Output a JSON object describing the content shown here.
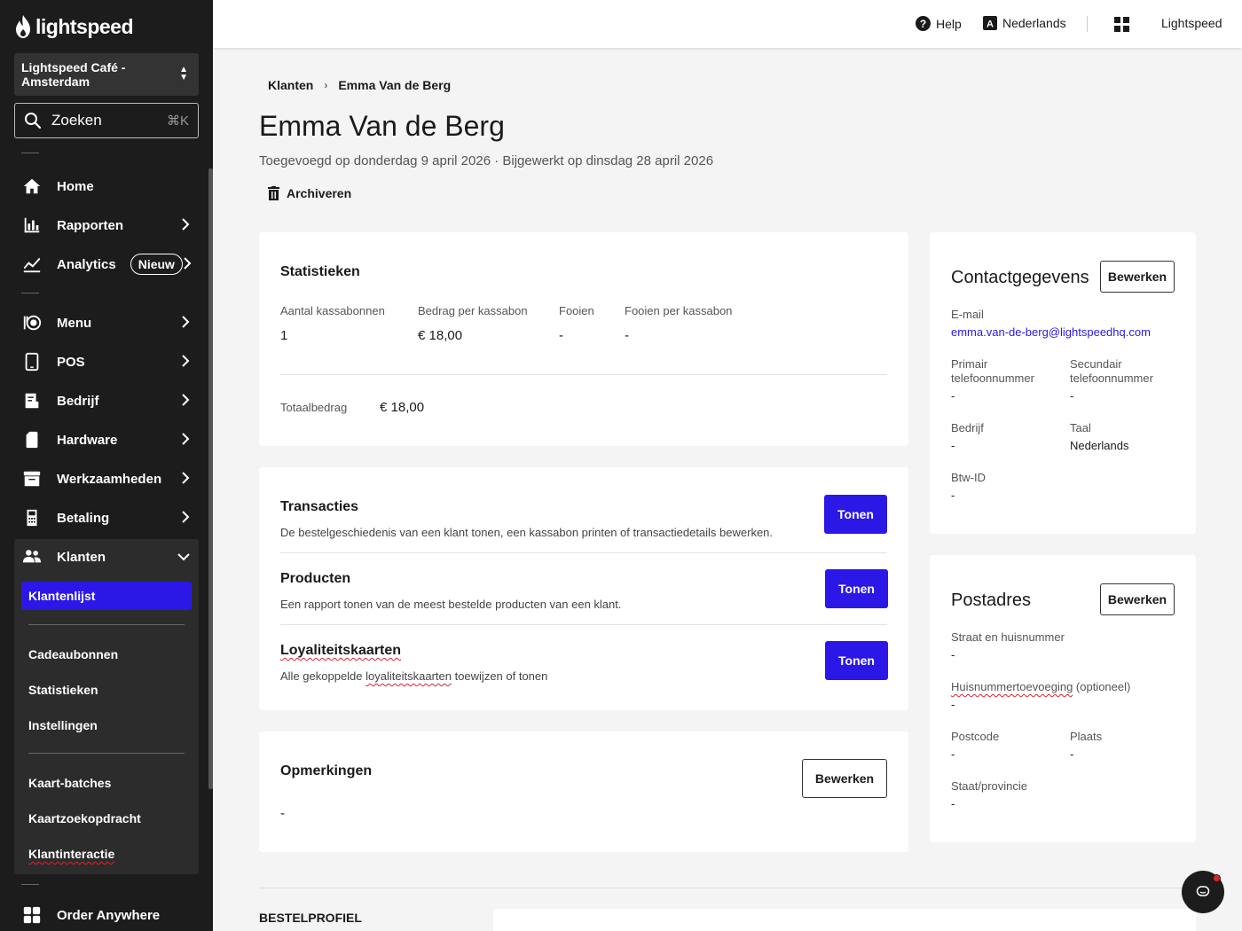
{
  "sidebar": {
    "brand": "lightspeed",
    "store": "Lightspeed Café - Amsterdam",
    "search": {
      "label": "Zoeken",
      "shortcut": "⌘K"
    },
    "items": [
      {
        "label": "Home"
      },
      {
        "label": "Rapporten"
      },
      {
        "label": "Analytics",
        "badge": "Nieuw"
      },
      {
        "label": "Menu"
      },
      {
        "label": "POS"
      },
      {
        "label": "Bedrijf"
      },
      {
        "label": "Hardware"
      },
      {
        "label": "Werkzaamheden"
      },
      {
        "label": "Betaling"
      },
      {
        "label": "Klanten"
      },
      {
        "label": "Order Anywhere"
      }
    ],
    "sub": [
      "Klantenlijst",
      "Cadeaubonnen",
      "Statistieken",
      "Instellingen",
      "Kaart-batches",
      "Kaartzoekopdracht",
      "Klantinteractie"
    ]
  },
  "topbar": {
    "help": "Help",
    "language": "Nederlands",
    "account": "Lightspeed"
  },
  "breadcrumb": {
    "parent": "Klanten",
    "current": "Emma Van de Berg"
  },
  "page": {
    "title": "Emma Van de Berg",
    "subtitle": "Toegevoegd op donderdag 9 april 2026 · Bijgewerkt op dinsdag 28 april 2026",
    "archive": "Archiveren"
  },
  "stats": {
    "title": "Statistieken",
    "labels": [
      "Aantal kassabonnen",
      "Bedrag per kassabon",
      "Fooien",
      "Fooien per kassabon"
    ],
    "values": [
      "1",
      "€ 18,00",
      "-",
      "-"
    ],
    "total_label": "Totaalbedrag",
    "total_value": "€ 18,00"
  },
  "actions": {
    "button": "Tonen",
    "rows": [
      {
        "title": "Transacties",
        "desc": "De bestelgeschiedenis van een klant tonen, een kassabon printen of transactiedetails bewerken."
      },
      {
        "title": "Producten",
        "desc": "Een rapport tonen van de meest bestelde producten van een klant."
      },
      {
        "title": "Loyaliteitskaarten",
        "desc_pre": "Alle gekoppelde ",
        "desc_word": "loyaliteitskaarten",
        "desc_post": " toewijzen of tonen"
      }
    ]
  },
  "notes": {
    "title": "Opmerkingen",
    "button": "Bewerken",
    "value": "-"
  },
  "contact": {
    "title": "Contactgegevens",
    "button": "Bewerken",
    "email_label": "E-mail",
    "email": "emma.van-de-berg@lightspeedhq.com",
    "phone1_label": "Primair telefoonnummer",
    "phone1": "-",
    "phone2_label": "Secundair telefoonnummer",
    "phone2": "-",
    "company_label": "Bedrijf",
    "company": "-",
    "lang_label": "Taal",
    "lang": "Nederlands",
    "vat_label": "Btw-ID",
    "vat": "-"
  },
  "address": {
    "title": "Postadres",
    "button": "Bewerken",
    "street_label": "Straat en huisnummer",
    "street": "-",
    "suffix_label_word": "Huisnummertoevoeging",
    "suffix_label_rest": " (optioneel)",
    "suffix": "-",
    "zip_label": "Postcode",
    "zip": "-",
    "city_label": "Plaats",
    "city": "-",
    "state_label": "Staat/provincie",
    "state": "-"
  },
  "bottom": {
    "section": "BESTELPROFIEL"
  },
  "colors": {
    "accent": "#2c18e6",
    "sidebar": "#1c1c1c"
  }
}
